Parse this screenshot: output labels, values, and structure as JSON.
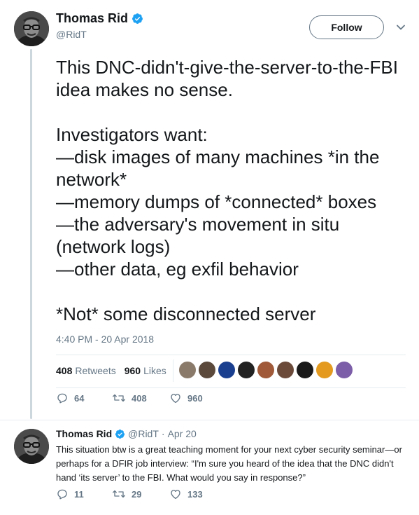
{
  "main_tweet": {
    "display_name": "Thomas Rid",
    "handle": "@RidT",
    "follow_label": "Follow",
    "text": "This DNC-didn't-give-the-server-to-the-FBI idea makes no sense.\n\nInvestigators want:\n—disk images of many machines *in the network*\n—memory dumps of *connected* boxes\n—the adversary's movement in situ (network logs)\n—other data, eg exfil behavior\n\n*Not* some disconnected server",
    "timestamp": "4:40 PM - 20 Apr 2018",
    "retweets_count": "408",
    "retweets_label": "Retweets",
    "likes_count": "960",
    "likes_label": "Likes",
    "liker_colors": [
      "#8a7a6a",
      "#5b4a3c",
      "#1b3f8f",
      "#222222",
      "#a05a3a",
      "#6b4a3a",
      "#1a1a1a",
      "#e39a1f",
      "#7b5ea7"
    ],
    "reply_count": "64",
    "retweet_count": "408",
    "like_count": "960"
  },
  "reply_tweet": {
    "display_name": "Thomas Rid",
    "handle": "@RidT",
    "separator": "·",
    "date": "Apr 20",
    "text": "This situation btw is a great teaching moment for your next cyber security seminar—or perhaps for a DFIR job interview: “I'm sure you heard of the idea that the DNC didn't hand ‘its server’ to the FBI. What would you say in response?”",
    "reply_count": "11",
    "retweet_count": "29",
    "like_count": "133"
  },
  "colors": {
    "verified": "#1da1f2",
    "muted": "#657786",
    "text": "#14171a",
    "rule": "#e6ecf0"
  },
  "icons": [
    "verified-badge-icon",
    "chevron-down-icon",
    "reply-icon",
    "retweet-icon",
    "like-icon"
  ]
}
